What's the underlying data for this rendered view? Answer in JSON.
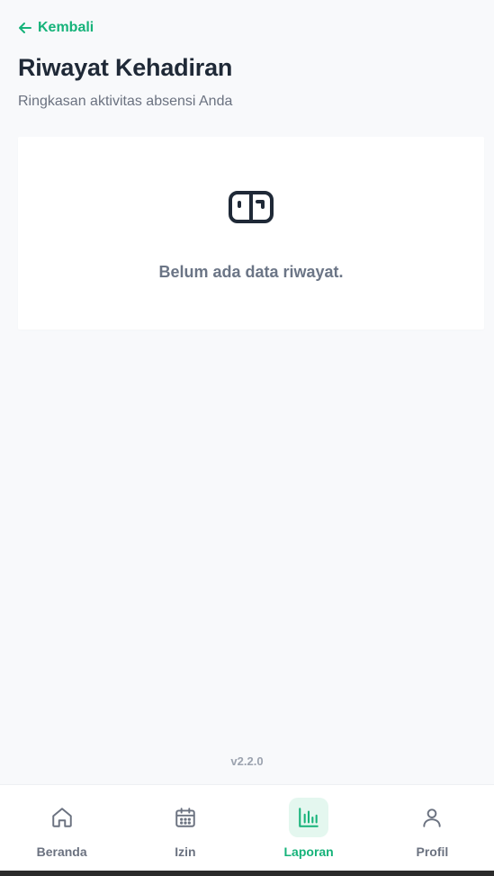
{
  "header": {
    "back_label": "Kembali",
    "title": "Riwayat Kehadiran",
    "subtitle": "Ringkasan aktivitas absensi Anda"
  },
  "empty_state": {
    "icon": "inbox-icon",
    "message": "Belum ada data riwayat."
  },
  "footer": {
    "version": "v2.2.0"
  },
  "nav": {
    "items": [
      {
        "label": "Beranda",
        "icon": "home-icon",
        "active": false
      },
      {
        "label": "Izin",
        "icon": "calendar-icon",
        "active": false
      },
      {
        "label": "Laporan",
        "icon": "bar-chart-icon",
        "active": true
      },
      {
        "label": "Profil",
        "icon": "user-icon",
        "active": false
      }
    ]
  },
  "colors": {
    "accent": "#16b37a",
    "accent_bg": "#e4f7ef",
    "text_dark": "#1f2937",
    "text_muted": "#6b7280",
    "background": "#f8f9fb"
  }
}
